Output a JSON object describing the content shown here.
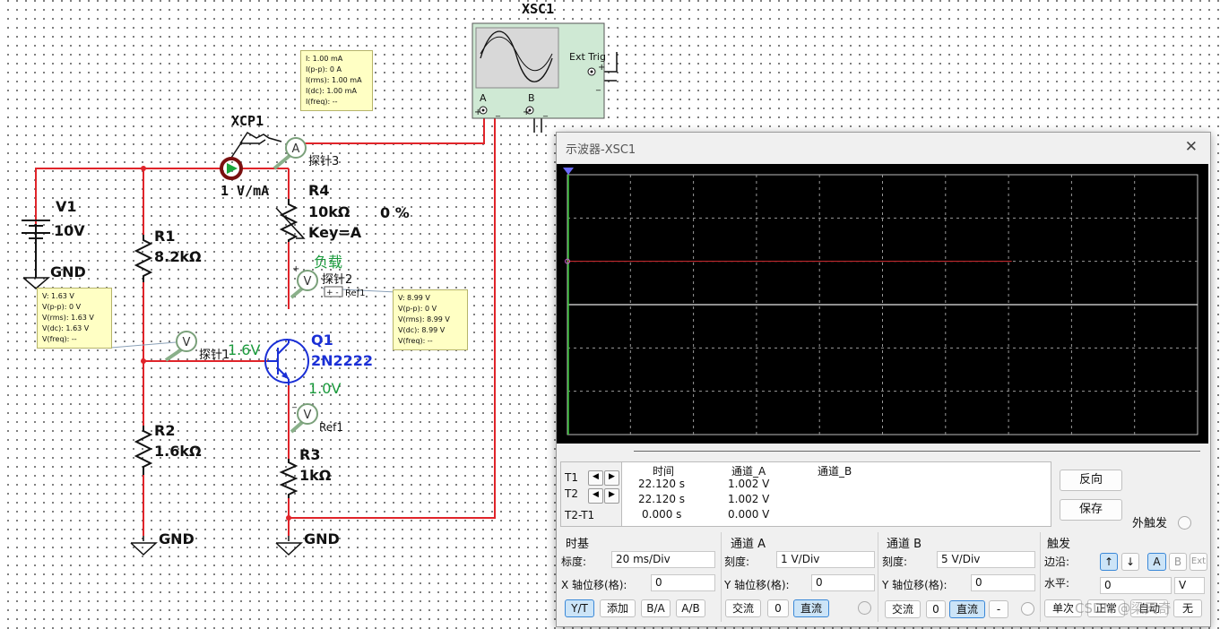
{
  "schematic": {
    "oscilloscope_label": "XSC1",
    "ext_trig_label": "Ext Trig",
    "channel_a": "A",
    "channel_b": "B",
    "plus": "+",
    "minus": "_",
    "current_probe_label": "XCP1",
    "current_probe_ratio": "1  V/mA",
    "v1_name": "V1",
    "v1_value": "10V",
    "gnd": "GND",
    "r1_name": "R1",
    "r1_value": "8.2kΩ",
    "r2_name": "R2",
    "r2_value": "1.6kΩ",
    "r3_name": "R3",
    "r3_value": "1kΩ",
    "r4_name": "R4",
    "r4_value": "10kΩ",
    "r4_percent": "0 %",
    "r4_key": "Key=A",
    "q1_name": "Q1",
    "q1_model": "2N2222",
    "load_label": "负载",
    "base_voltage": "1.6V",
    "emitter_voltage": "1.0V",
    "probe1_label": "探针1",
    "probe2_label": "探针2",
    "probe3_label": "探针3",
    "ref1_label": "Ref1",
    "ref1_tag": "+ -",
    "ammeter_glyph": "A",
    "voltmeter_glyph": "V"
  },
  "probe3_box": [
    "I: 1.00 mA",
    "I(p-p): 0 A",
    "I(rms): 1.00 mA",
    "I(dc): 1.00 mA",
    "I(freq): --"
  ],
  "probe1_box": [
    "V: 1.63 V",
    "V(p-p): 0 V",
    "V(rms): 1.63 V",
    "V(dc): 1.63 V",
    "V(freq): --"
  ],
  "probe2_box": [
    "V: 8.99 V",
    "V(p-p): 0 V",
    "V(rms): 8.99 V",
    "V(dc): 8.99 V",
    "V(freq): --"
  ],
  "scope_window": {
    "title": "示波器-XSC1",
    "close": "✕",
    "readout": {
      "headers": [
        "时间",
        "通道_A",
        "通道_B"
      ],
      "rows": [
        {
          "label": "T1",
          "time": "22.120 s",
          "a": "1.002 V",
          "b": ""
        },
        {
          "label": "T2",
          "time": "22.120 s",
          "a": "1.002 V",
          "b": ""
        },
        {
          "label": "T2-T1",
          "time": "0.000 s",
          "a": "0.000 V",
          "b": ""
        }
      ]
    },
    "reverse_button": "反向",
    "save_button": "保存",
    "ext_trigger_label": "外触发",
    "timebase": {
      "title": "时基",
      "scale_label": "标度:",
      "scale_value": "20 ms/Div",
      "xpos_label": "X 轴位移(格):",
      "xpos_value": "0",
      "modes": [
        "Y/T",
        "添加",
        "B/A",
        "A/B"
      ]
    },
    "channel_a_panel": {
      "title": "通道 A",
      "scale_label": "刻度:",
      "scale_value": "1  V/Div",
      "ypos_label": "Y 轴位移(格):",
      "ypos_value": "0",
      "coupling": [
        "交流",
        "0",
        "直流"
      ]
    },
    "channel_b_panel": {
      "title": "通道 B",
      "scale_label": "刻度:",
      "scale_value": "5  V/Div",
      "ypos_label": "Y 轴位移(格):",
      "ypos_value": "0",
      "coupling": [
        "交流",
        "0",
        "直流",
        "-"
      ]
    },
    "trigger": {
      "title": "触发",
      "edge_label": "边沿:",
      "edge_buttons": [
        "↑",
        "↓",
        "A",
        "B",
        "Ext"
      ],
      "level_label": "水平:",
      "level_value": "0",
      "level_unit": "V",
      "modes": [
        "单次",
        "正常",
        "自动",
        "无"
      ]
    },
    "trace": {
      "channel": "A",
      "value_v": 1.002,
      "color": "#c0282c"
    }
  },
  "watermark": "CSDN @梁天奇"
}
